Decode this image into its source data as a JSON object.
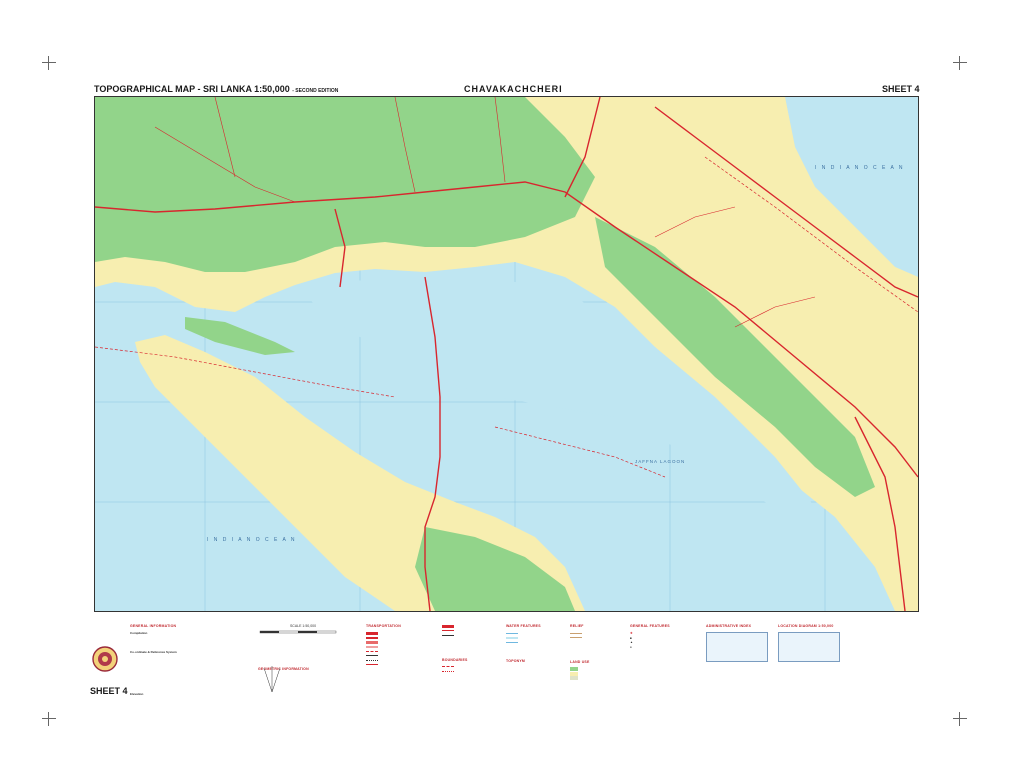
{
  "header": {
    "series_title": "TOPOGRAPHICAL MAP - SRI LANKA 1:50,000",
    "edition": "- SECOND EDITION",
    "map_name": "CHAVAKACHCHERI",
    "sheet": "SHEET 4"
  },
  "map_labels": {
    "ocean_north": "I N D I A N   O C E A N",
    "ocean_south": "I N D I A N   O C E A N",
    "lagoon": "JAFFNA LAGOON"
  },
  "legend": {
    "general_information": "GENERAL INFORMATION",
    "compilation": "Compilation",
    "coordinate_system": "Co-ordinate & Reference System",
    "elevation": "Elevation",
    "scale": "SCALE 1:50,000",
    "geometric_information": "GEOMETRIC INFORMATION",
    "transportation": "TRANSPORTATION",
    "boundaries": "BOUNDARIES",
    "water_features": "WATER FEATURES",
    "toponym": "TOPONYM",
    "relief": "RELIEF",
    "land_use": "LAND USE",
    "general_features": "GENERAL FEATURES",
    "administrative_index": "ADMINISTRATIVE INDEX",
    "location_diagram": "LOCATION DIAGRAM 1:50,000"
  },
  "footer": {
    "sheet": "SHEET 4"
  },
  "colors": {
    "water": "#bfe6f2",
    "vegetation": "#92d48a",
    "settlement": "#f7eeb0",
    "road": "#d8262e",
    "boundary": "#d8262e",
    "legend_heading": "#c0282e"
  }
}
